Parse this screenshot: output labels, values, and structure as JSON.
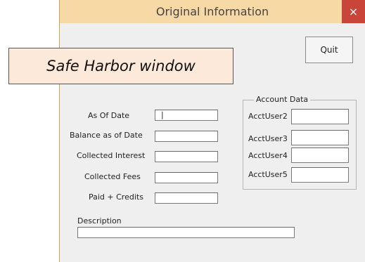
{
  "window": {
    "title": "Original Information",
    "close_icon": "×",
    "titlebar_color": "#f7d9a6",
    "close_color": "#c9453a"
  },
  "quit_label": "Quit",
  "overlay_label": "Safe Harbor window",
  "fields": [
    {
      "label": "As Of Date",
      "value": "|"
    },
    {
      "label": "Balance as of Date",
      "value": ""
    },
    {
      "label": "Collected Interest",
      "value": ""
    },
    {
      "label": "Collected Fees",
      "value": ""
    },
    {
      "label": "Paid + Credits",
      "value": ""
    }
  ],
  "account_data": {
    "title": "Account Data",
    "fields": [
      {
        "label": "AcctUser2",
        "value": ""
      },
      {
        "label": "AcctUser3",
        "value": ""
      },
      {
        "label": "AcctUser4",
        "value": ""
      },
      {
        "label": "AcctUser5",
        "value": ""
      }
    ]
  },
  "description": {
    "label": "Description",
    "value": ""
  }
}
